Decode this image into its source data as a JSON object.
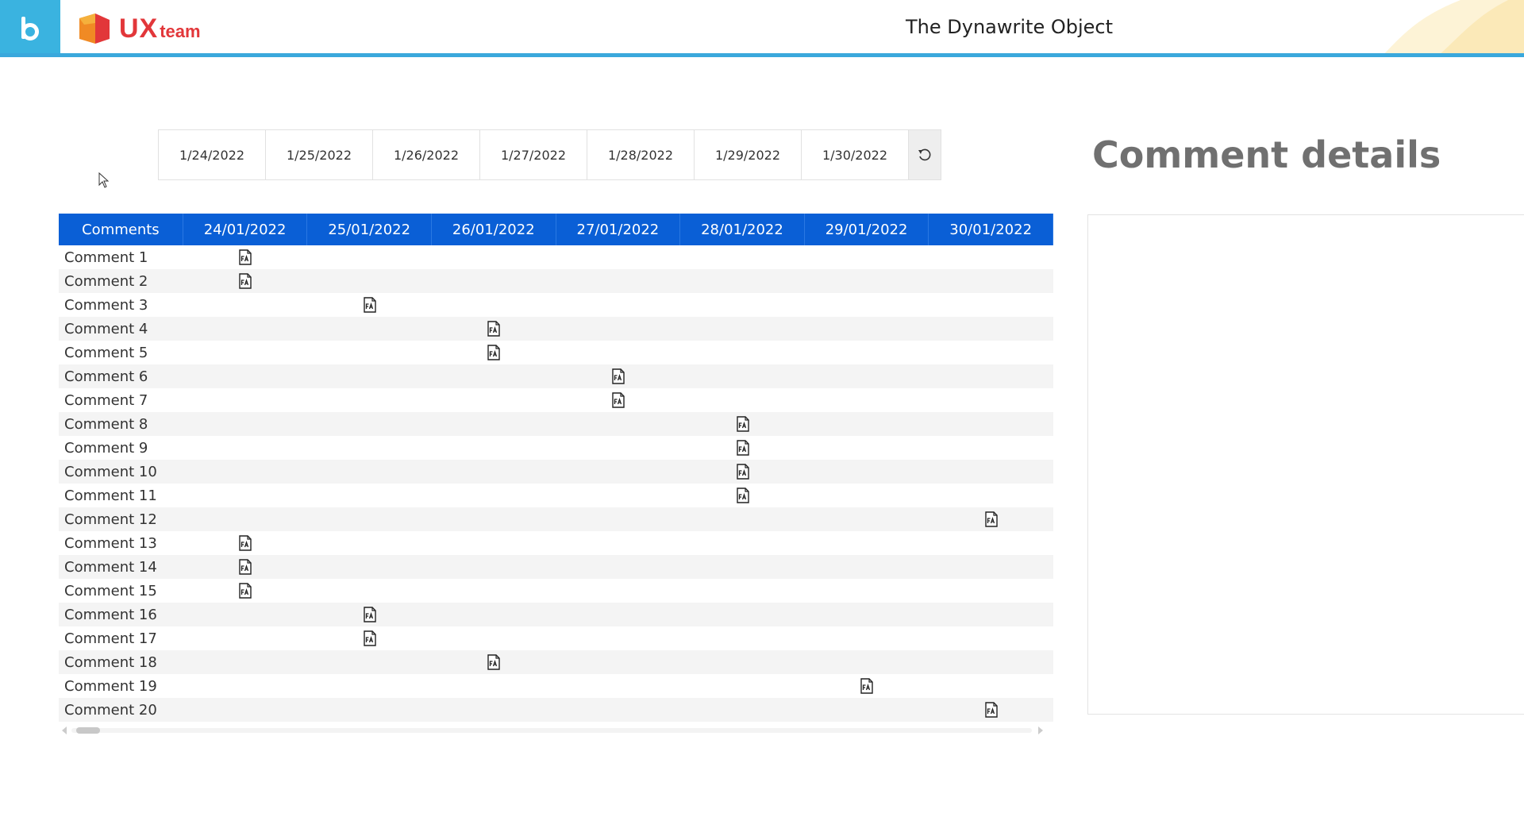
{
  "header": {
    "logo_ux": "UX",
    "logo_team": "team",
    "app_title": "The Dynawrite Object",
    "accent_color": "#3aa8dc"
  },
  "date_filter": {
    "dates": [
      "1/24/2022",
      "1/25/2022",
      "1/26/2022",
      "1/27/2022",
      "1/28/2022",
      "1/29/2022",
      "1/30/2022"
    ],
    "reset_icon": "reset-icon"
  },
  "grid": {
    "header_color": "#0a5fd6",
    "first_column_label": "Comments",
    "columns": [
      "24/01/2022",
      "25/01/2022",
      "26/01/2022",
      "27/01/2022",
      "28/01/2022",
      "29/01/2022",
      "30/01/2022"
    ],
    "rows": [
      {
        "name": "Comment 1",
        "date_col": 0
      },
      {
        "name": "Comment 2",
        "date_col": 0
      },
      {
        "name": "Comment 3",
        "date_col": 1
      },
      {
        "name": "Comment 4",
        "date_col": 2
      },
      {
        "name": "Comment 5",
        "date_col": 2
      },
      {
        "name": "Comment 6",
        "date_col": 3
      },
      {
        "name": "Comment 7",
        "date_col": 3
      },
      {
        "name": "Comment 8",
        "date_col": 4
      },
      {
        "name": "Comment 9",
        "date_col": 4
      },
      {
        "name": "Comment 10",
        "date_col": 4
      },
      {
        "name": "Comment 11",
        "date_col": 4
      },
      {
        "name": "Comment 12",
        "date_col": 6
      },
      {
        "name": "Comment 13",
        "date_col": 0
      },
      {
        "name": "Comment 14",
        "date_col": 0
      },
      {
        "name": "Comment 15",
        "date_col": 0
      },
      {
        "name": "Comment 16",
        "date_col": 1
      },
      {
        "name": "Comment 17",
        "date_col": 1
      },
      {
        "name": "Comment 18",
        "date_col": 2
      },
      {
        "name": "Comment 19",
        "date_col": 5
      },
      {
        "name": "Comment 20",
        "date_col": 6
      }
    ],
    "cell_icon": "document-icon"
  },
  "details": {
    "title": "Comment details"
  }
}
